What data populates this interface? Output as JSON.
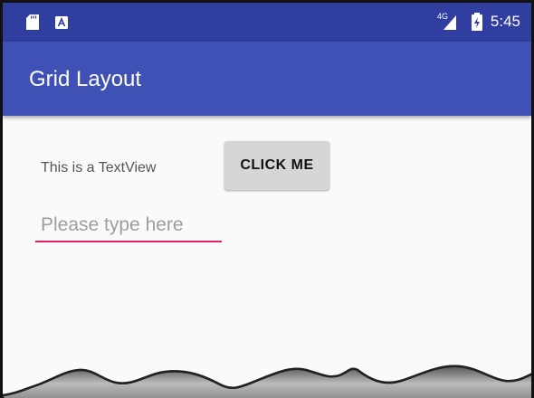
{
  "status_bar": {
    "network": "4G",
    "time": "5:45",
    "icons": [
      "sd-card-icon",
      "a-notification-icon",
      "signal-icon",
      "battery-charging-icon"
    ]
  },
  "app_bar": {
    "title": "Grid Layout"
  },
  "content": {
    "textview_text": "This is a TextView",
    "button_label": "CLICK ME",
    "edittext_placeholder": "Please type here",
    "edittext_value": ""
  },
  "colors": {
    "status_bar": "#303f9f",
    "app_bar": "#3f51b5",
    "accent": "#e91e63",
    "button": "#d6d6d6",
    "background": "#fafafa"
  }
}
